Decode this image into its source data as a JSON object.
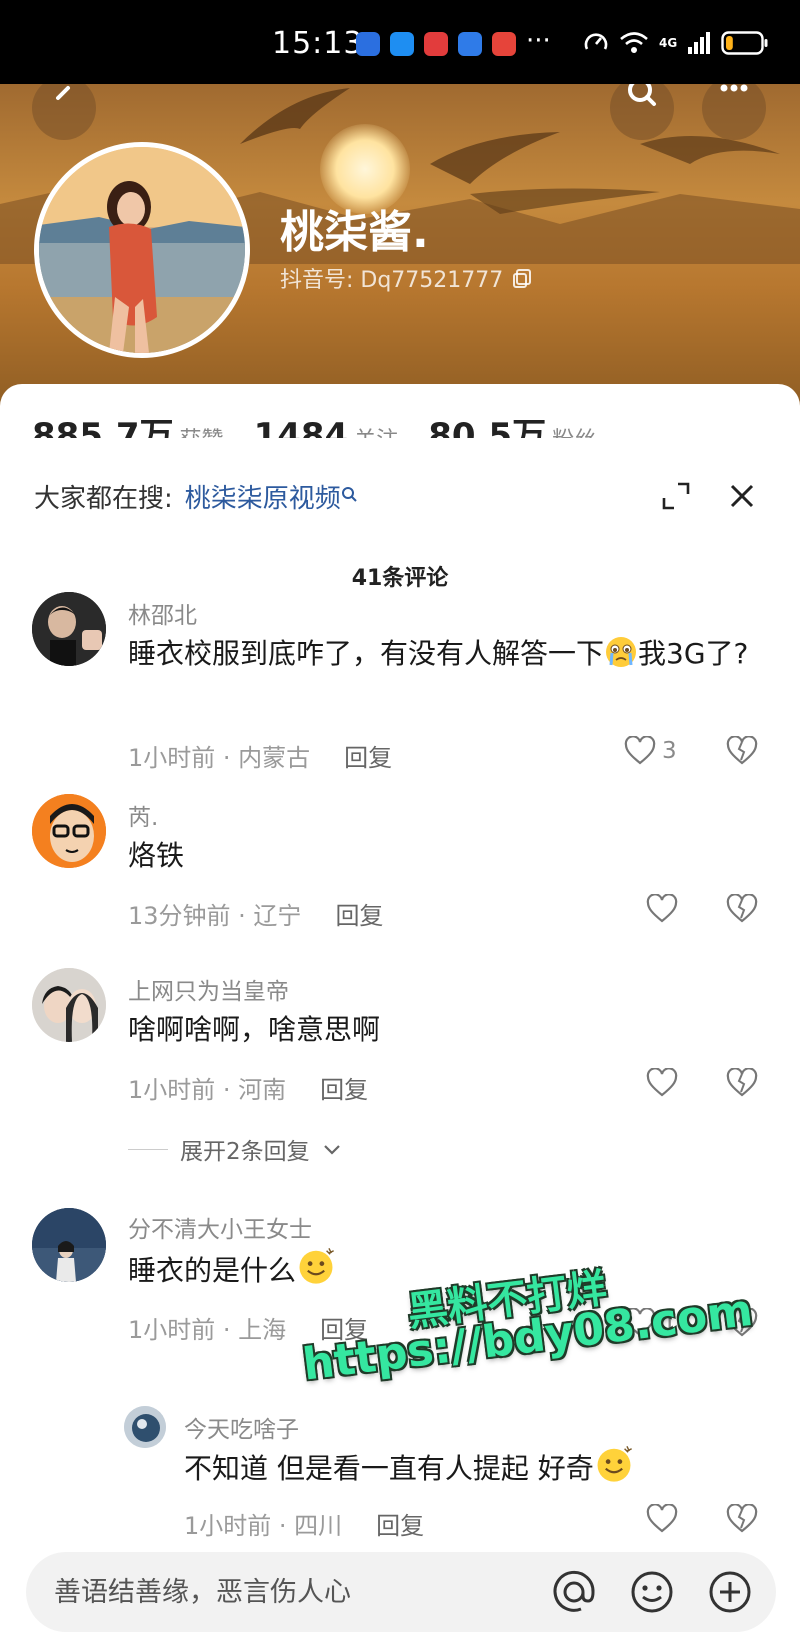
{
  "status_bar": {
    "time": "15:13",
    "app_icons": [
      "a",
      "b",
      "c",
      "d",
      "e"
    ],
    "more": "···",
    "network": "4G",
    "battery_level": 0.2
  },
  "profile": {
    "name": "桃柒酱.",
    "id": "抖音号: Dq77521777",
    "stats": [
      {
        "value": "885.7万",
        "label": "获赞"
      },
      {
        "value": "1484",
        "label": "关注"
      },
      {
        "value": "80.5万",
        "label": "粉丝"
      }
    ]
  },
  "search_suggestion": {
    "label": "大家都在搜:",
    "keyword": "桃柒柒原视频"
  },
  "comments_header": "41条评论",
  "comments": [
    {
      "user": "林邵北",
      "text": "睡衣校服到底咋了，有没有人解答一下",
      "text_tail": "我3G了?",
      "time": "1小时前 · 内蒙古",
      "reply": "回复",
      "likes": "3"
    },
    {
      "user": "芮.",
      "text": "烙铁",
      "time": "13分钟前 · 辽宁",
      "reply": "回复",
      "likes": ""
    },
    {
      "user": "上网只为当皇帝",
      "text": "啥啊啥啊，啥意思啊",
      "time": "1小时前 · 河南",
      "reply": "回复",
      "likes": "",
      "expand": "展开2条回复"
    },
    {
      "user": "分不清大小王女士",
      "text": "睡衣的是什么",
      "time": "1小时前 · 上海",
      "reply": "回复",
      "likes": "1"
    }
  ],
  "reply": {
    "user": "今天吃啥子",
    "text": "不知道 但是看一直有人提起 好奇",
    "time": "1小时前 · 四川",
    "reply": "回复"
  },
  "watermark": {
    "line1": "黑料不打烊",
    "line2": "https://bdy08.com"
  },
  "input": {
    "placeholder": "善语结善缘，恶言伤人心"
  },
  "colors": {
    "link_blue": "#2d5a9e",
    "watermark_green": "#35e7a0"
  }
}
